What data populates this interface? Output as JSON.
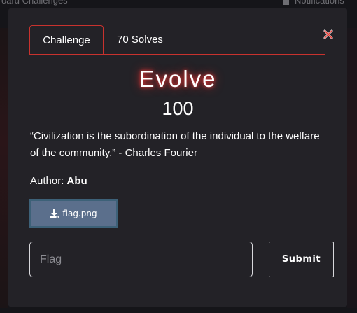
{
  "background": {
    "nav_left": "oard    Challenges",
    "nav_right": "Notifications"
  },
  "tabs": [
    {
      "label": "Challenge",
      "active": true
    },
    {
      "label": "70 Solves",
      "active": false
    }
  ],
  "close_icon": "close-icon",
  "challenge": {
    "name": "Evolve",
    "points": "100",
    "description": "“Civilization is the subordination of the individual to the welfare of the community.” - Charles Fourier",
    "author_label": "Author: ",
    "author_name": "Abu"
  },
  "file": {
    "icon": "download-icon",
    "label": "flag.png"
  },
  "form": {
    "flag_placeholder": "Flag",
    "flag_value": "",
    "submit_label": "Submit"
  },
  "colors": {
    "accent": "#c8322e",
    "modal_bg": "#232227",
    "file_button": "#5b6f8c"
  }
}
